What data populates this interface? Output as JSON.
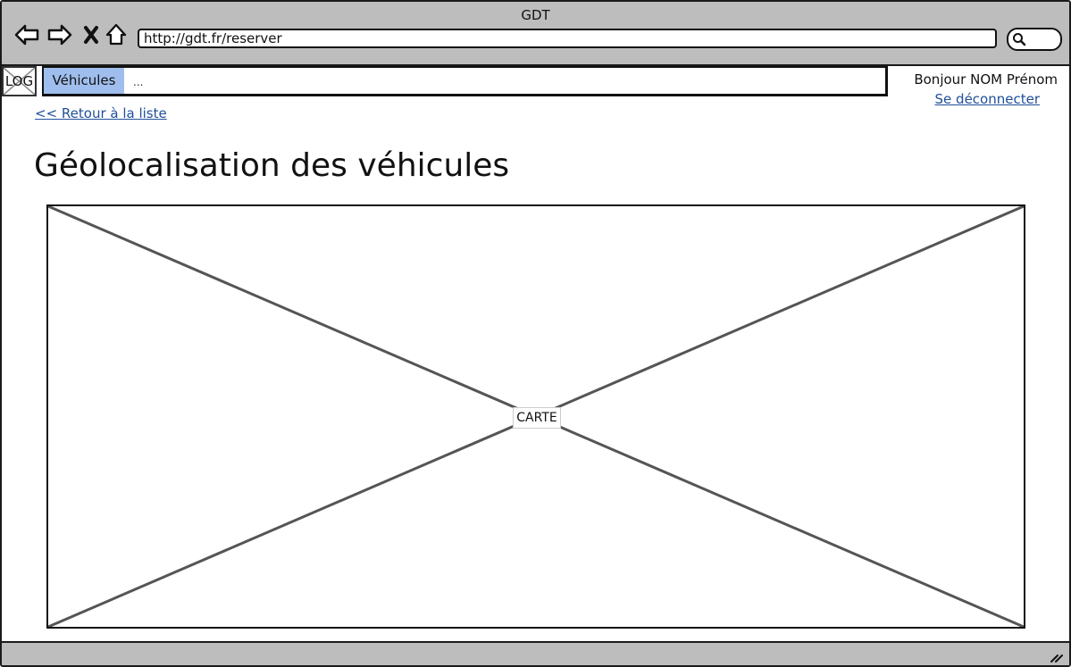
{
  "window": {
    "title": "GDT"
  },
  "browser": {
    "url": "http://gdt.fr/reserver",
    "icons": [
      "back-arrow-icon",
      "forward-arrow-icon",
      "close-icon",
      "home-icon",
      "search-icon"
    ]
  },
  "header": {
    "logo_text": "LOG",
    "nav": {
      "active_tab": "Véhicules",
      "more": "..."
    },
    "greeting": "Bonjour NOM Prénom",
    "logout": "Se déconnecter"
  },
  "main": {
    "back_link": "<< Retour à la liste",
    "title": "Géolocalisation des véhicules",
    "map_label": "CARTE"
  },
  "colors": {
    "chrome": "#bdbdbd",
    "active_tab": "#9fbeee",
    "link": "#1f4f9a"
  }
}
